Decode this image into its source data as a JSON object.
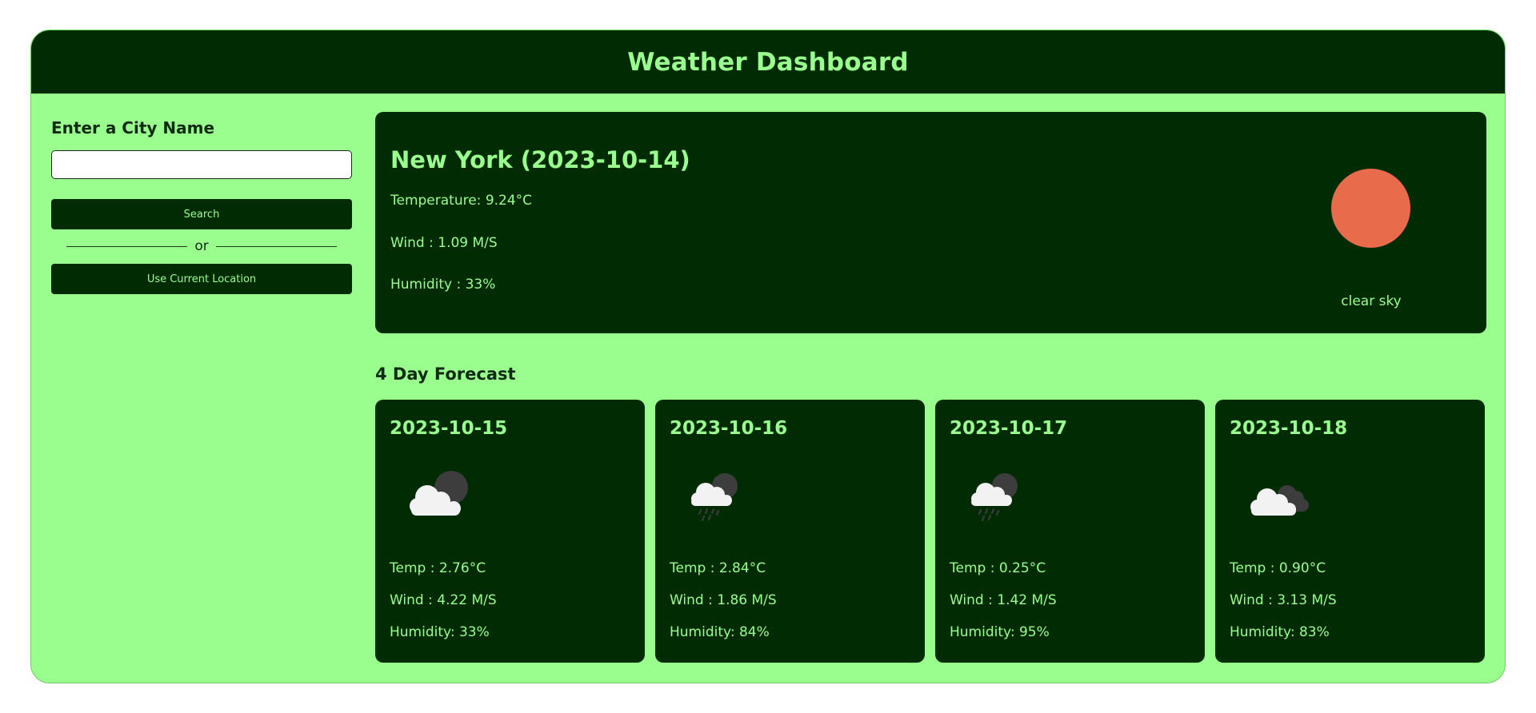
{
  "header": {
    "title": "Weather Dashboard"
  },
  "sidebar": {
    "heading": "Enter a City Name",
    "input_value": "",
    "search_label": "Search",
    "divider_text": "or",
    "location_label": "Use Current Location"
  },
  "current": {
    "city_date": "New York (2023-10-14)",
    "temperature": "Temperature: 9.24°C",
    "wind": "Wind : 1.09 M/S",
    "humidity": "Humidity : 33%",
    "description": "clear sky",
    "icon": "clear-sky-sun-icon",
    "sun_color": "#e86b4c"
  },
  "forecast": {
    "title": "4 Day Forecast",
    "days": [
      {
        "date": "2023-10-15",
        "icon": "partly-cloudy-night-icon",
        "temp": "Temp : 2.76°C",
        "wind": "Wind : 4.22 M/S",
        "humidity": "Humidity: 33%"
      },
      {
        "date": "2023-10-16",
        "icon": "rain-night-icon",
        "temp": "Temp : 2.84°C",
        "wind": "Wind : 1.86 M/S",
        "humidity": "Humidity: 84%"
      },
      {
        "date": "2023-10-17",
        "icon": "rain-night-icon",
        "temp": "Temp : 0.25°C",
        "wind": "Wind : 1.42 M/S",
        "humidity": "Humidity: 95%"
      },
      {
        "date": "2023-10-18",
        "icon": "overcast-clouds-icon",
        "temp": "Temp : 0.90°C",
        "wind": "Wind : 3.13 M/S",
        "humidity": "Humidity: 83%"
      }
    ]
  },
  "colors": {
    "accent": "#9afe8e",
    "dark": "#012c03"
  }
}
